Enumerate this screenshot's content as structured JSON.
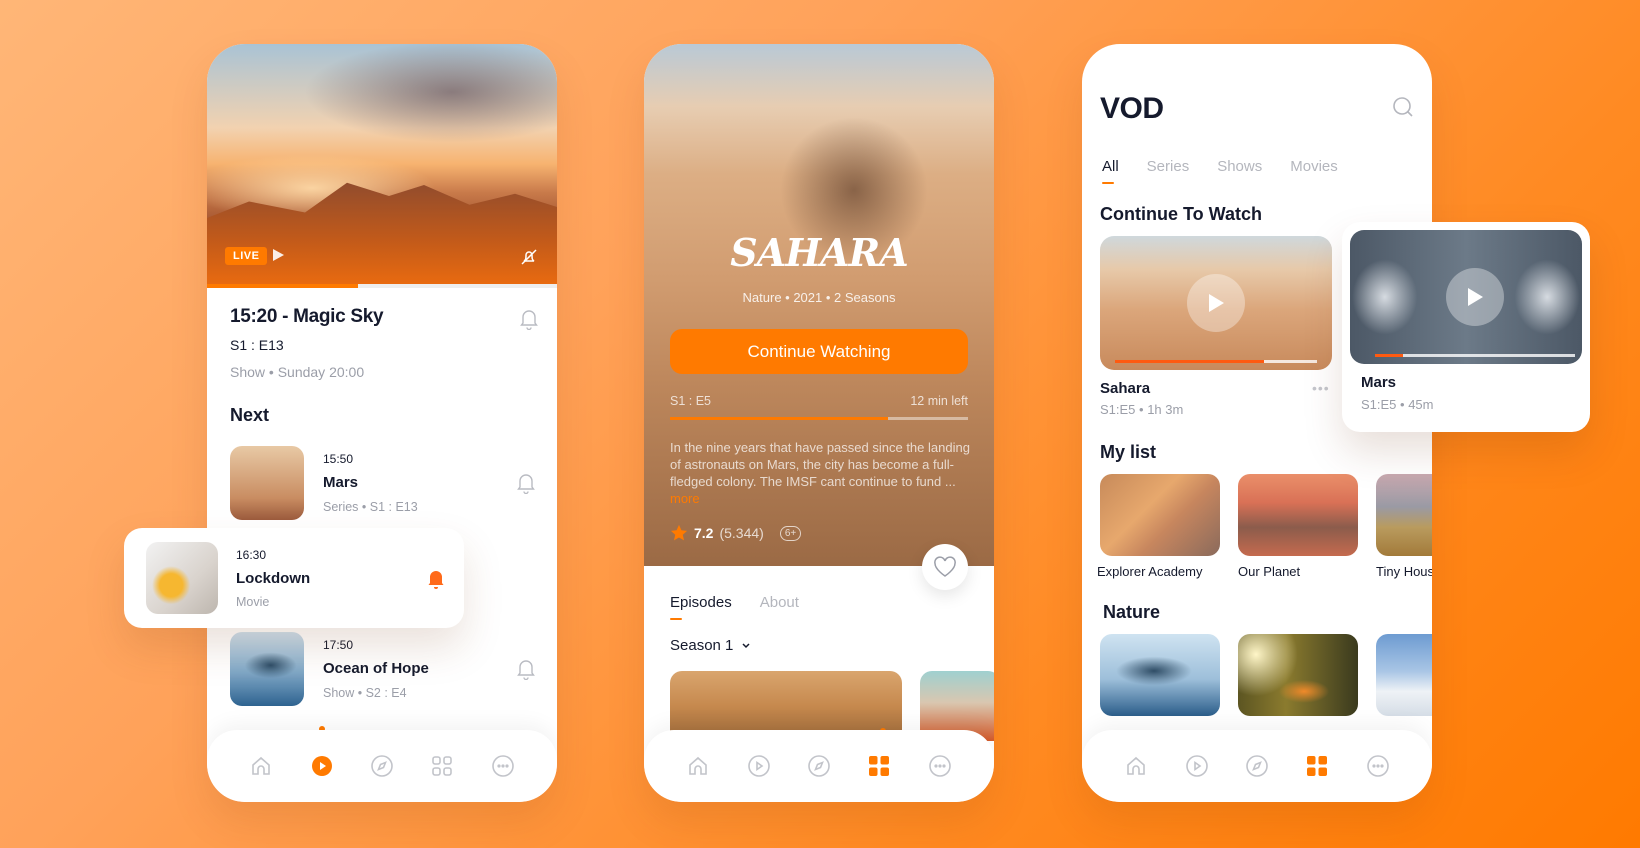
{
  "colors": {
    "accent": "#ff7a00",
    "text": "#151a2d",
    "muted": "#9b9ea8"
  },
  "phone1": {
    "badge": "LIVE",
    "progress": 0.43,
    "title": "15:20 - Magic Sky",
    "episode": "S1 : E13",
    "meta": "Show  •  Sunday 20:00",
    "next_heading": "Next",
    "items": [
      {
        "time": "15:50",
        "name": "Mars",
        "meta": "Series  •  S1 : E13",
        "reminder": false
      },
      {
        "time": "16:30",
        "name": "Lockdown",
        "meta": "Movie",
        "reminder": true
      },
      {
        "time": "17:50",
        "name": "Ocean of Hope",
        "meta": "Show  •  S2 : E4",
        "reminder": false
      }
    ],
    "nav_active": "play"
  },
  "phone2": {
    "logo": "SAHARA",
    "meta": "Nature  •  2021  •  2 Seasons",
    "cta": "Continue Watching",
    "episode": "S1 : E5",
    "time_left": "12 min left",
    "progress": 0.73,
    "description": "In the nine years that have passed since the landing of astronauts on Mars, the city has become a full-fledged colony. The IMSF cant continue to fund ...",
    "more": "more",
    "rating": "7.2",
    "votes": "(5.344)",
    "age": "6+",
    "tabs": [
      "Episodes",
      "About"
    ],
    "season": "Season 1",
    "nav_active": "grid"
  },
  "phone3": {
    "title": "VOD",
    "tabs": [
      "All",
      "Series",
      "Shows",
      "Movies"
    ],
    "continue_heading": "Continue To Watch",
    "continue": [
      {
        "title": "Sahara",
        "meta": "S1:E5  •  1h 3m",
        "progress": 0.74
      },
      {
        "title": "Mars",
        "meta": "S1:E5  •  45m",
        "progress": 0.14
      }
    ],
    "mylist_heading": "My list",
    "mylist": [
      "Explorer Academy",
      "Our Planet",
      "Tiny House"
    ],
    "nature_heading": "Nature",
    "nav_active": "grid"
  }
}
